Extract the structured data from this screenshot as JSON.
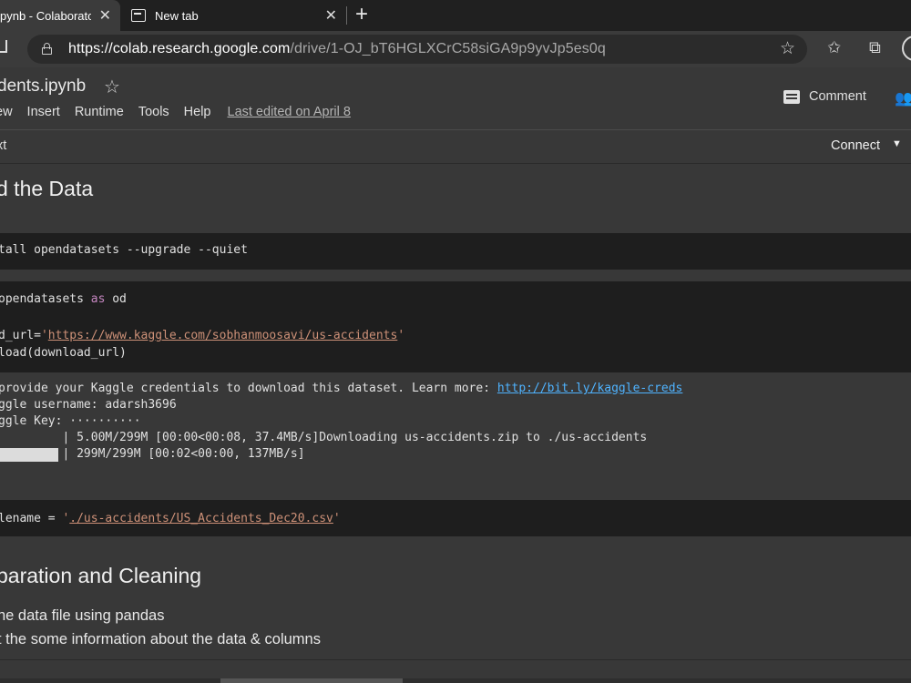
{
  "browser": {
    "tabs": [
      {
        "title": "pynb - Colaboratory",
        "close": "✕"
      },
      {
        "title": "New tab",
        "close": "✕"
      }
    ],
    "new_tab": "+",
    "url_host": "https://colab.research.google.com",
    "url_path": "/drive/1-OJ_bT6HGLXCrC58siGA9p9yvJp5es0q",
    "icons": [
      "home-icon",
      "lock-icon",
      "add-favorite-icon",
      "favorites-icon",
      "collections-icon",
      "profile-icon"
    ]
  },
  "colab": {
    "notebook_title": "dents.ipynb",
    "menu": [
      "ew",
      "Insert",
      "Runtime",
      "Tools",
      "Help"
    ],
    "last_edited": "Last edited on April 8",
    "comment_label": "Comment",
    "toolbar_text": "xt",
    "connect_label": "Connect"
  },
  "cells": {
    "heading1": "d the Data",
    "cell1_line1": "tall opendatasets --upgrade --quiet",
    "cell2_line1_a": "opendatasets ",
    "cell2_line1_kw": "as",
    "cell2_line1_b": " od",
    "cell2_line3_a": "d_url=",
    "cell2_line3_q1": "'",
    "cell2_line3_link": "https://www.kaggle.com/sobhanmoosavi/us-accidents",
    "cell2_line3_q2": "'",
    "cell2_line4": "load(download_url)",
    "out_line1_a": "provide your Kaggle credentials to download this dataset. Learn more: ",
    "out_line1_link": "http://bit.ly/kaggle-creds",
    "out_line2": "ggle username: adarsh3696",
    "out_line3": "ggle Key: ··········",
    "out_line4": "         | 5.00M/299M [00:00<00:08, 37.4MB/s]Downloading us-accidents.zip to ./us-accidents",
    "out_line5": "         | 299M/299M [00:02<00:00, 137MB/s]",
    "progress_complete": 1.0,
    "cell3_a": "lename = ",
    "cell3_q1": "'",
    "cell3_link": "./us-accidents/US_Accidents_Dec20.csv",
    "cell3_q2": "'",
    "heading2": "paration and Cleaning",
    "md_line1": "he data file using pandas",
    "md_line2": "t the some information about the data & columns"
  }
}
